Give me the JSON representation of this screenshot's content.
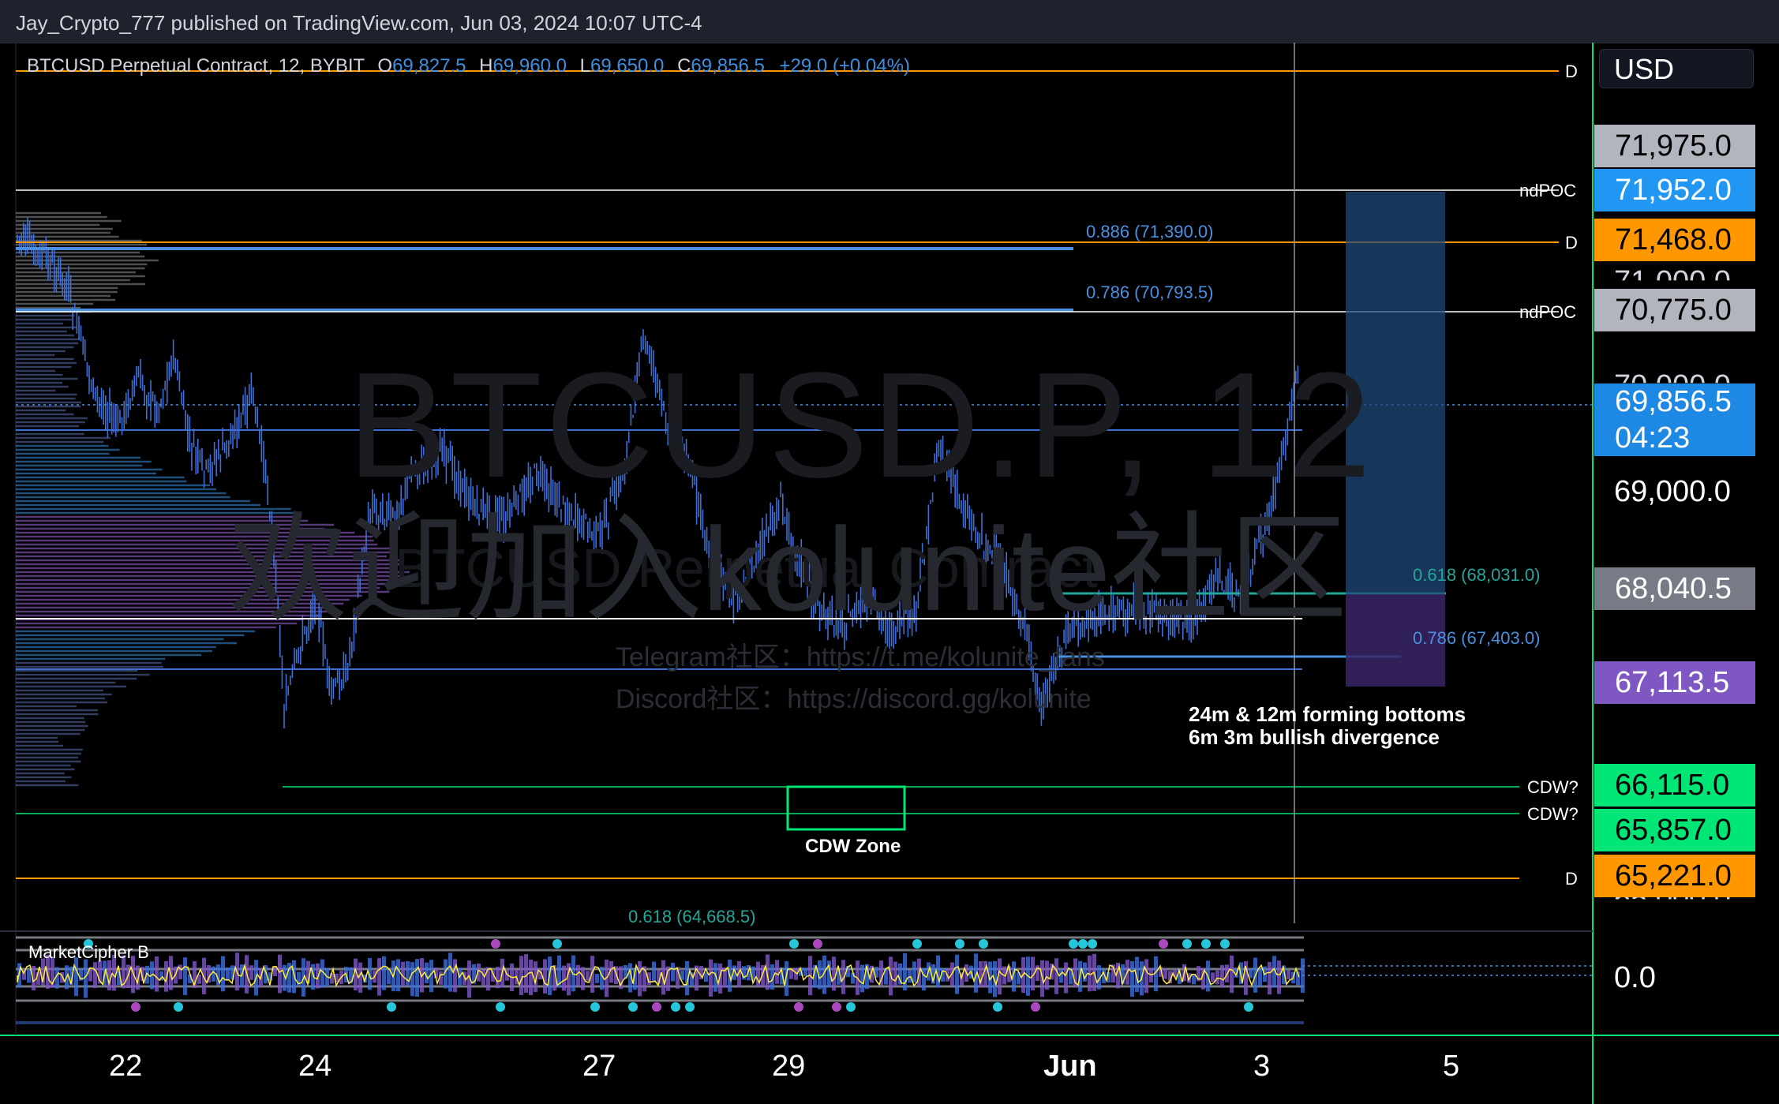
{
  "header": {
    "publish_line": "Jay_Crypto_777 published on TradingView.com, Jun 03, 2024 10:07 UTC-4"
  },
  "legend": {
    "symbol": "BTCUSD Perpetual Contract, 12, BYBIT",
    "o_label": "O",
    "o_value": "69,827.5",
    "h_label": "H",
    "h_value": "69,960.0",
    "l_label": "L",
    "l_value": "69,650.0",
    "c_label": "C",
    "c_value": "69,856.5",
    "change": "+29.0 (+0.04%)"
  },
  "currency": "USD",
  "watermark": {
    "symbol": "BTCUSD.P, 12",
    "community": "欢迎加入kolunite社区",
    "contract": "BTCUSD Perpetual Contract",
    "telegram": "Telegram社区：https://t.me/kolunite_fans",
    "discord": "Discord社区：https://discord.gg/kolunite"
  },
  "price_axis": {
    "tags": [
      {
        "id": "p71975",
        "text": "71,975.0",
        "bg": "#b2b5be",
        "fg": "#000000"
      },
      {
        "id": "p71952",
        "text": "71,952.0",
        "bg": "#2196f3",
        "fg": "#ffffff"
      },
      {
        "id": "p71468",
        "text": "71,468.0",
        "bg": "#ff9800",
        "fg": "#000000"
      },
      {
        "id": "p70775",
        "text": "70,775.0",
        "bg": "#b2b5be",
        "fg": "#000000"
      },
      {
        "id": "p69856",
        "text": "69,856.5",
        "bg": "#1e88e5",
        "fg": "#ffffff"
      },
      {
        "id": "countdown",
        "text": "04:23",
        "bg": "#1e88e5",
        "fg": "#ffffff"
      },
      {
        "id": "p68040",
        "text": "68,040.5",
        "bg": "#787b86",
        "fg": "#ffffff"
      },
      {
        "id": "p67113",
        "text": "67,113.5",
        "bg": "#7e57c2",
        "fg": "#ffffff"
      },
      {
        "id": "p66115",
        "text": "66,115.0",
        "bg": "#00e676",
        "fg": "#000000"
      },
      {
        "id": "p65857",
        "text": "65,857.0",
        "bg": "#00e676",
        "fg": "#000000"
      },
      {
        "id": "p65221",
        "text": "65,221.0",
        "bg": "#ff9800",
        "fg": "#000000"
      }
    ],
    "plain_69000": "69,000.0",
    "partial_71000": "71,000.0",
    "partial_70000": "70,000.0",
    "partial_65000": "65,000.0",
    "indicator_zero": "0.0"
  },
  "level_labels": {
    "d_top": "D",
    "ndpoc_1": "ndPOC",
    "d_mid": "D",
    "ndpoc_2": "ndPOC",
    "cdw_1": "CDW?",
    "cdw_2": "CDW?",
    "d_bottom": "D"
  },
  "fib_labels": {
    "f0886": "0.886 (71,390.0)",
    "f0786_top": "0.786 (70,793.5)",
    "f0618_right": "0.618 (68,031.0)",
    "f0786_right": "0.786 (67,403.0)",
    "f0618_bottom": "0.618 (64,668.5)"
  },
  "annotations": {
    "bottoms_line1": "24m & 12m forming bottoms",
    "bottoms_line2": "6m 3m bullish divergence",
    "cdw_zone": "CDW Zone"
  },
  "indicator": {
    "name": "MarketCipher B"
  },
  "time_axis": {
    "ticks": [
      "22",
      "24",
      "27",
      "29",
      "Jun",
      "3",
      "5"
    ]
  },
  "colors": {
    "background": "#000000",
    "candle": "#3d6fd6",
    "fib_blue": "#4a90e2",
    "orange_level": "#ff9800",
    "green_level": "#00e676",
    "ndpoc": "#ffffff"
  }
}
